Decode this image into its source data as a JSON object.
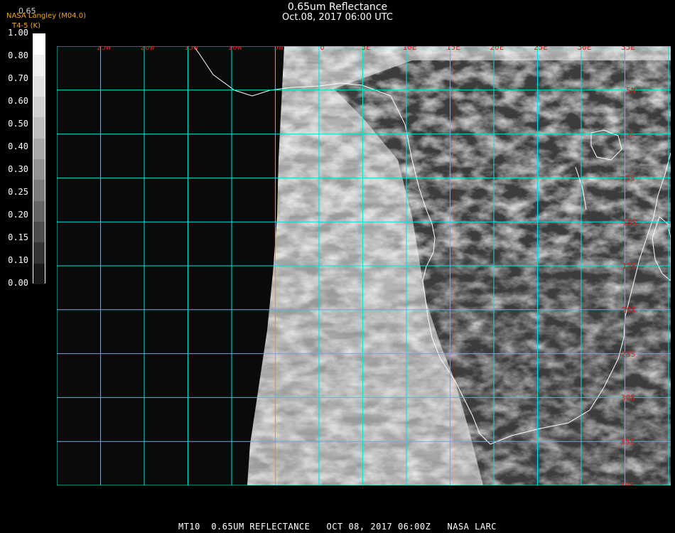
{
  "header": {
    "title": "0.65um Reflectance",
    "subtitle": "Oct.08, 2017 06:00 UTC",
    "credit": "NASA Langley (M04.0)",
    "credit_sub": "T4-5 (K)",
    "top_value": "0.65"
  },
  "colorbar": {
    "labels": [
      "1.00",
      "0.80",
      "0.70",
      "0.60",
      "0.50",
      "0.40",
      "0.30",
      "0.25",
      "0.20",
      "0.15",
      "0.10",
      "0.00"
    ],
    "shades": [
      "#ffffff",
      "#f0f0f0",
      "#e0e0e0",
      "#cfcfcf",
      "#bdbdbd",
      "#a8a8a8",
      "#939393",
      "#7c7c7c",
      "#656565",
      "#4d4d4d",
      "#343434",
      "#1a1a1a"
    ]
  },
  "map": {
    "lon_labels": [
      "25W",
      "20W",
      "15W",
      "10W",
      "5W",
      "0",
      "5E",
      "10E",
      "15E",
      "20E",
      "25E",
      "30E",
      "35E"
    ],
    "lat_labels": [
      "5N",
      "0",
      "5S",
      "10S",
      "15S",
      "20S",
      "25S",
      "30S",
      "35S",
      "40S"
    ],
    "colors": {
      "grid": "#00e0e0",
      "label": "#d92020",
      "coast": "#ffffff",
      "ocean_dark": "#0b0b0b"
    }
  },
  "footer": {
    "text": "MT10  0.65UM REFLECTANCE   OCT 08, 2017 06:00Z   NASA LARC"
  }
}
